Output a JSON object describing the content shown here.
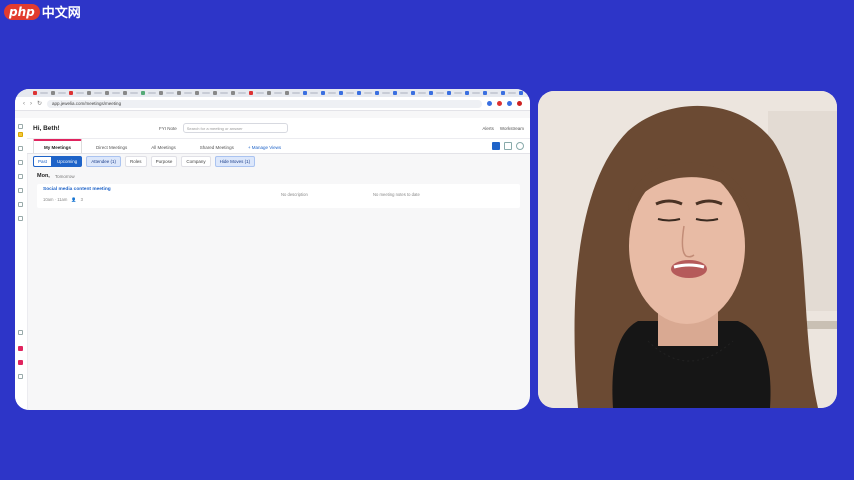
{
  "watermark": {
    "logo": "php",
    "text": "中文网"
  },
  "browser": {
    "url": "app.jewelia.com/meetings/meeting",
    "tab_colors": [
      "#d33",
      "#888",
      "#d33",
      "#888",
      "#888",
      "#888",
      "#5a7",
      "#888",
      "#888",
      "#888",
      "#888",
      "#888",
      "#d33",
      "#888",
      "#888",
      "#3a6fe0",
      "#3a6fe0",
      "#3a6fe0",
      "#3a6fe0",
      "#3a6fe0",
      "#3a6fe0",
      "#3a6fe0",
      "#3a6fe0",
      "#3a6fe0",
      "#3a6fe0",
      "#3a6fe0",
      "#3a6fe0",
      "#3a6fe0",
      "#d33",
      "#3a6fe0"
    ]
  },
  "app": {
    "greeting": "Hi, Beth!",
    "fyi": "FYI Note",
    "search_placeholder": "Search for a meeting or answer",
    "alerts": "Alerts",
    "workspace": "Workstream",
    "tabs": [
      "My Meetings",
      "Direct Meetings",
      "All Meetings",
      "Shared Meetings"
    ],
    "manage_views": "+ Manage Views",
    "filters": {
      "past": "Past",
      "upcoming": "Upcoming",
      "chips": [
        "Attendee (1)",
        "Roles",
        "Purpose",
        "Company"
      ],
      "selected_chip": "Hide Moves (1)"
    },
    "date": {
      "day": "Mon,",
      "sub": "Tomorrow"
    },
    "meeting": {
      "title": "Social media content meeting",
      "meta_time": "10am · 11am",
      "meta_people": "3",
      "middle": "No description",
      "right": "No meeting notes to date"
    }
  },
  "video": {
    "subject": "woman speaking to camera"
  }
}
